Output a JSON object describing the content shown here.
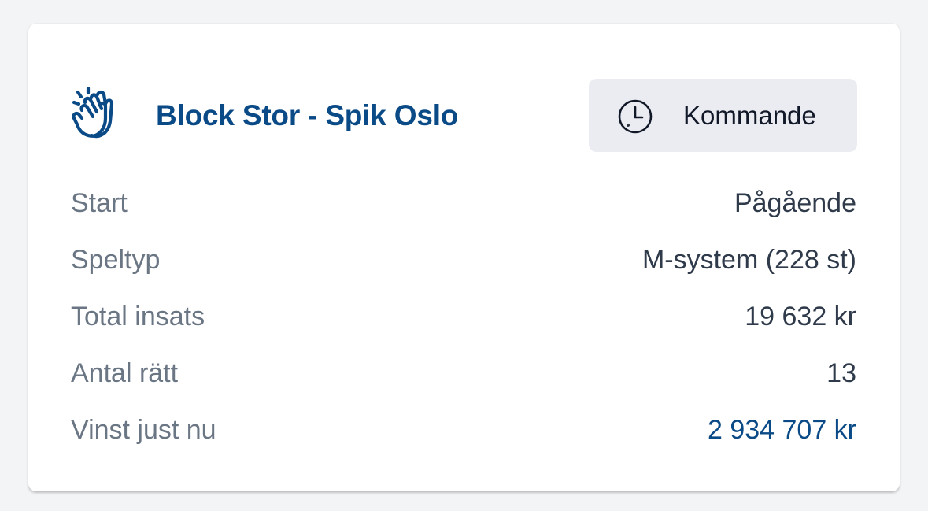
{
  "card": {
    "title": "Block Stor - Spik Oslo",
    "title_icon": "clapping-hands-icon",
    "status": {
      "label": "Kommande",
      "icon": "clock-icon"
    },
    "rows": [
      {
        "key": "Start",
        "value": "Pågående"
      },
      {
        "key": "Speltyp",
        "value": "M-system (228 st)"
      },
      {
        "key": "Total insats",
        "value": "19 632 kr"
      },
      {
        "key": "Antal rätt",
        "value": "13"
      },
      {
        "key": "Vinst just nu",
        "value": "2 934 707 kr"
      }
    ]
  },
  "colors": {
    "brand": "#0a4a86",
    "muted_text": "#6b7684",
    "value_text": "#2f3a4a",
    "chip_bg": "#ebebf2",
    "page_bg": "#f3f4f6"
  }
}
